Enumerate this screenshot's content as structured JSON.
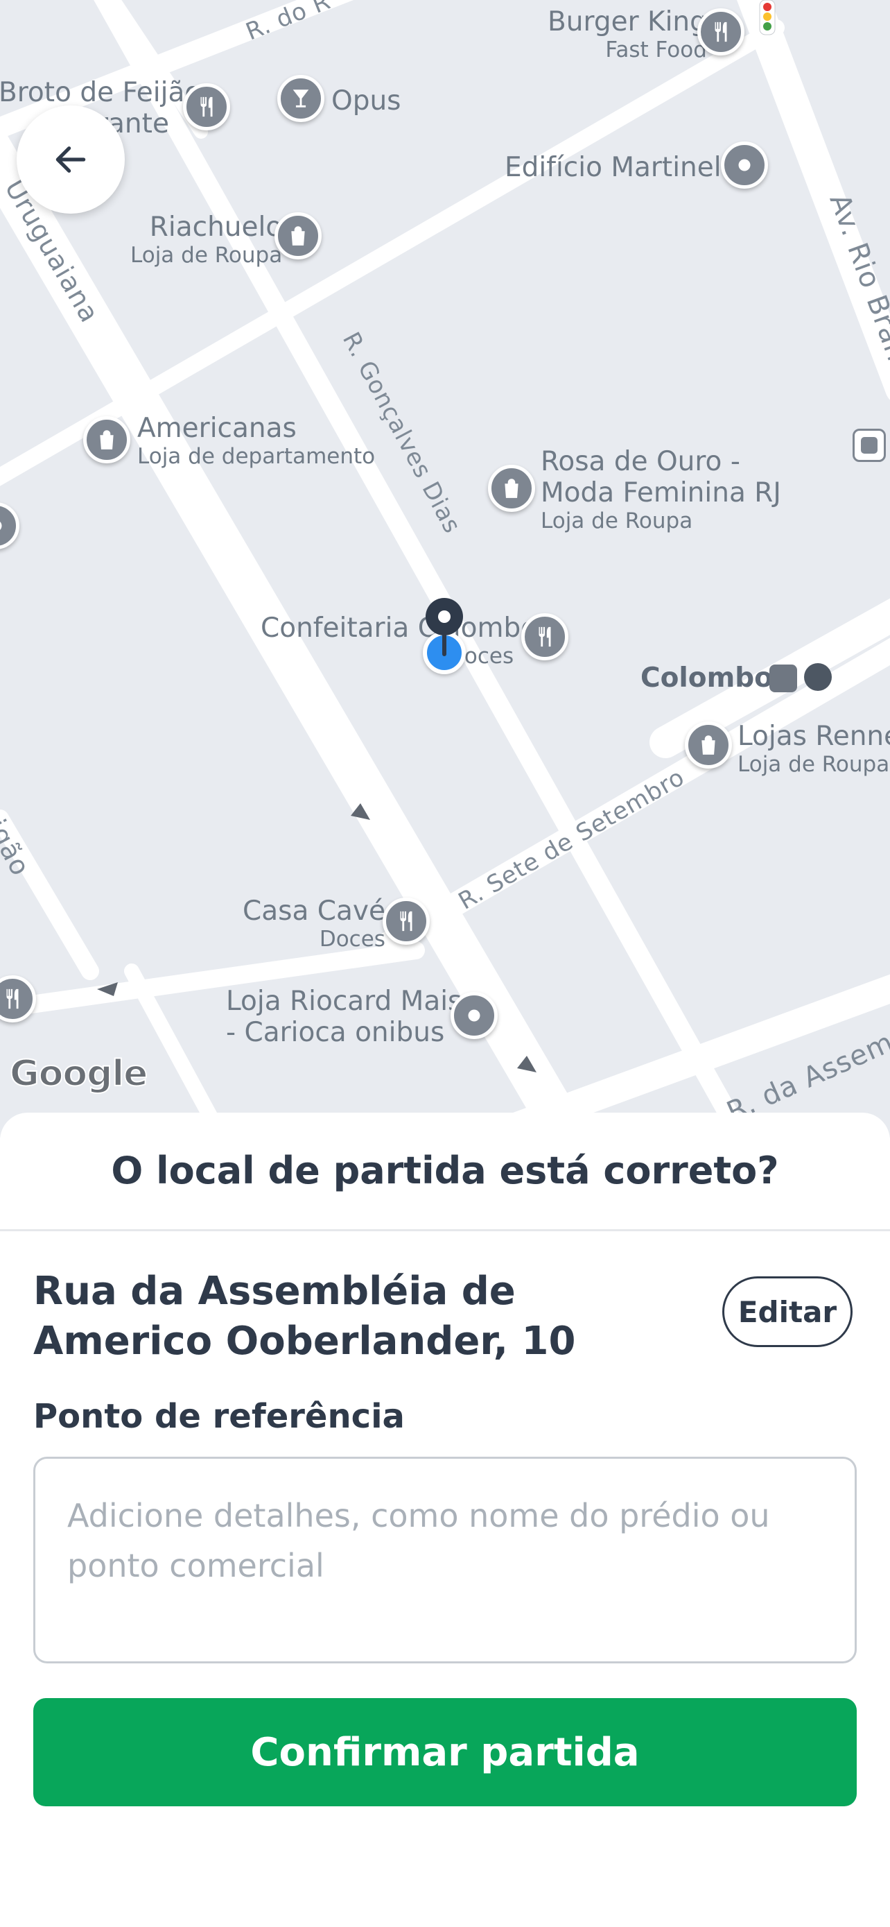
{
  "map": {
    "streets": {
      "r_do": "R. do R",
      "uruguaiana": "Uruguaiana",
      "goncalves_dias": "R. Gonçalves Dias",
      "rio_branco": "Av. Rio Branco",
      "sete_setembro": "R. Sete de Setembro",
      "assembleia": "R. da Assem",
      "left_lower": "igão"
    },
    "places": [
      {
        "id": "burger-king",
        "name": "Burger King",
        "category": "Fast Food",
        "icon": "restaurant-icon"
      },
      {
        "id": "broto-feijao",
        "name": "Broto de Feijão",
        "category": "rante",
        "icon": "restaurant-icon"
      },
      {
        "id": "opus",
        "name": "Opus",
        "category": "",
        "icon": "bar-icon"
      },
      {
        "id": "edificio-martinelli",
        "name": "Edifício Martinelli",
        "category": "",
        "icon": "poi-dot-icon"
      },
      {
        "id": "riachuelo",
        "name": "Riachuelo",
        "category": "Loja de Roupa",
        "icon": "shopping-bag-icon"
      },
      {
        "id": "americanas",
        "name": "Americanas",
        "category": "Loja de departamento",
        "icon": "shopping-bag-icon"
      },
      {
        "id": "rosa-ouro",
        "name": "Rosa de Ouro -",
        "name2": "Moda Feminina RJ",
        "category": "Loja de Roupa",
        "icon": "shopping-bag-icon"
      },
      {
        "id": "confeitaria",
        "name": "Confeitaria Colombo",
        "category": "Doces",
        "icon": "restaurant-icon"
      },
      {
        "id": "colombo",
        "name": "Colombo",
        "category": "",
        "icon": "tram-icon"
      },
      {
        "id": "lojas-renner",
        "name": "Lojas Renner",
        "category": "Loja de Roupa",
        "icon": "shopping-bag-icon"
      },
      {
        "id": "casa-cave",
        "name": "Casa Cavé",
        "category": "Doces",
        "icon": "restaurant-icon"
      },
      {
        "id": "loja-riocard",
        "name": "Loja Riocard Mais",
        "name2": "- Carioca onibus",
        "category": "",
        "icon": "poi-dot-icon"
      }
    ],
    "logo": "Google"
  },
  "sheet": {
    "title": "O local de partida está correto?",
    "address": "Rua da Assembléia de Americo Ooberlander, 10",
    "edit_label": "Editar",
    "reference_label": "Ponto de referência",
    "reference_placeholder": "Adicione detalhes, como nome do prédio ou ponto comercial",
    "reference_value": "",
    "confirm_label": "Confirmar partida"
  },
  "colors": {
    "accent": "#08a65a",
    "text": "#2f3a4a",
    "map_bg": "#e8ebf0",
    "pin": "#7e8691",
    "user_location": "#2d8ef0"
  }
}
